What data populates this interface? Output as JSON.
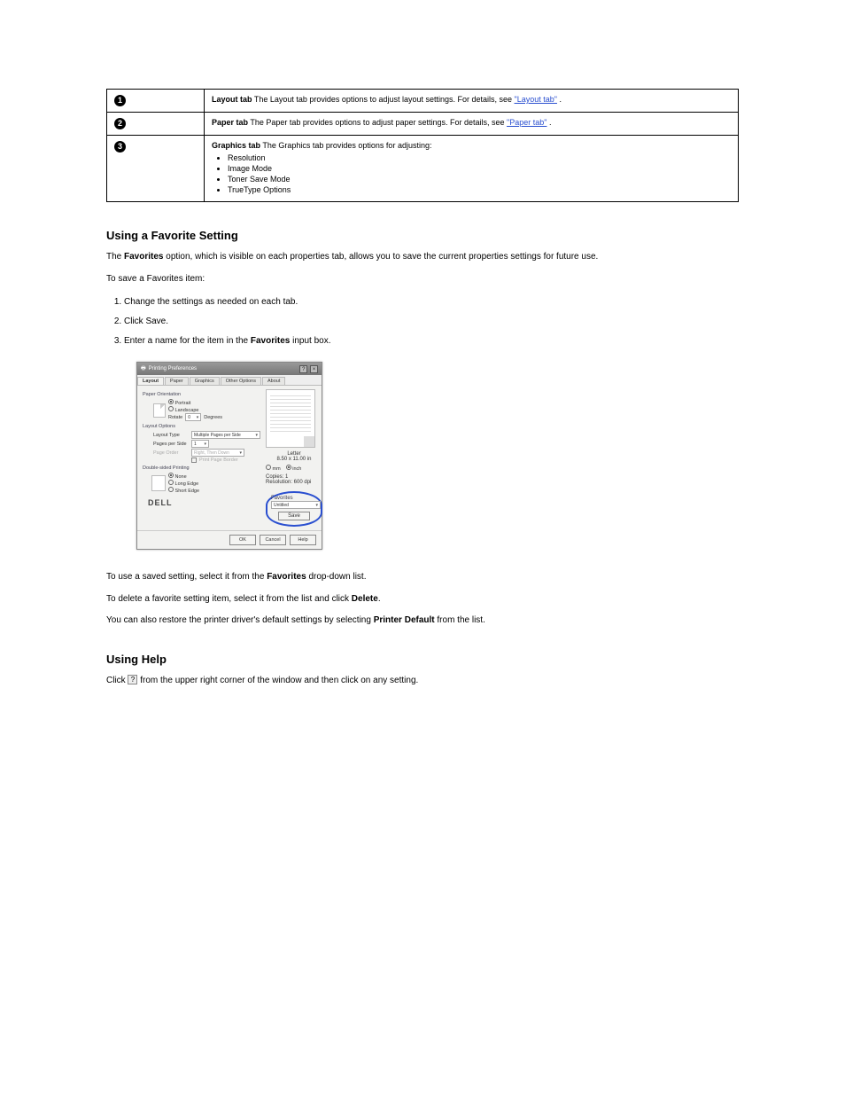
{
  "table": {
    "rows": [
      {
        "num": "1",
        "label": "Layout tab",
        "desc_text": "The Layout tab provides options to adjust layout settings. For details, see ",
        "link": "\"Layout tab\"",
        "tail": "."
      },
      {
        "num": "2",
        "label": "Paper tab",
        "desc_text": "The Paper tab provides options to adjust paper settings. For details, see ",
        "link": "\"Paper tab\"",
        "tail": "."
      },
      {
        "num": "3",
        "label": "Graphics tab",
        "desc_prefix": "The Graphics tab provides options for adjusting:",
        "bullets": [
          "Resolution",
          "Image Mode",
          "Toner Save Mode",
          "TrueType Options"
        ]
      }
    ]
  },
  "favorites": {
    "heading": "Using a Favorite Setting",
    "para1_a": "The ",
    "para1_b_strong": "Favorites",
    "para1_c": " option, which is visible on each properties tab, allows you to save the current properties settings for future use.",
    "para2": "To save a Favorites item:",
    "steps": [
      {
        "t": "Change the settings as needed on each tab."
      },
      {
        "t": "Click Save."
      },
      {
        "t_a": "Enter a name for the item in the ",
        "strong": "Favorites",
        "t_b": " input box."
      }
    ],
    "after1_a": "To use a saved setting, select it from the ",
    "after1_strong": "Favorites",
    "after1_b": " drop-down list.",
    "after2_a": "To delete a favorite setting item, select it from the list and click ",
    "after2_strong": "Delete",
    "after2_b": ".",
    "after3_a": "You can also restore the printer driver's default settings by selecting ",
    "after3_strong": "Printer Default",
    "after3_b": " from the list."
  },
  "dialog": {
    "title": "Printing Preferences",
    "tabs": [
      "Layout",
      "Paper",
      "Graphics",
      "Other Options",
      "About"
    ],
    "active_tab": "Layout",
    "grp_orientation": "Paper Orientation",
    "orient": {
      "portrait": "Portrait",
      "landscape": "Landscape",
      "rotate": "Rotate",
      "rotate_val": "0",
      "degrees": "Degrees"
    },
    "grp_layout": "Layout Options",
    "layout": {
      "type_label": "Layout Type",
      "type_value": "Multiple Pages per Side",
      "pps_label": "Pages per Side",
      "pps_value": "1",
      "order_label": "Page Order",
      "order_value": "Right, Then Down",
      "border_label": "Print Page Border"
    },
    "grp_duplex": "Double-sided Printing",
    "duplex": {
      "none": "None",
      "long": "Long Edge",
      "short": "Short Edge"
    },
    "preview": {
      "size_name": "Letter",
      "size_dims": "8.50 x 11.00 in",
      "copies_label": "Copies: 1",
      "res_label": "Resolution: 600 dpi",
      "mm": "mm",
      "inch": "inch"
    },
    "fav_label": "Favorites",
    "fav_value": "Untitled",
    "save": "Save",
    "logo": "DELL",
    "buttons": {
      "ok": "OK",
      "cancel": "Cancel",
      "help": "Help"
    }
  },
  "help": {
    "heading": "Using Help",
    "p_a": "Click ",
    "p_b": " from the upper right corner of the window and then click on any setting."
  }
}
